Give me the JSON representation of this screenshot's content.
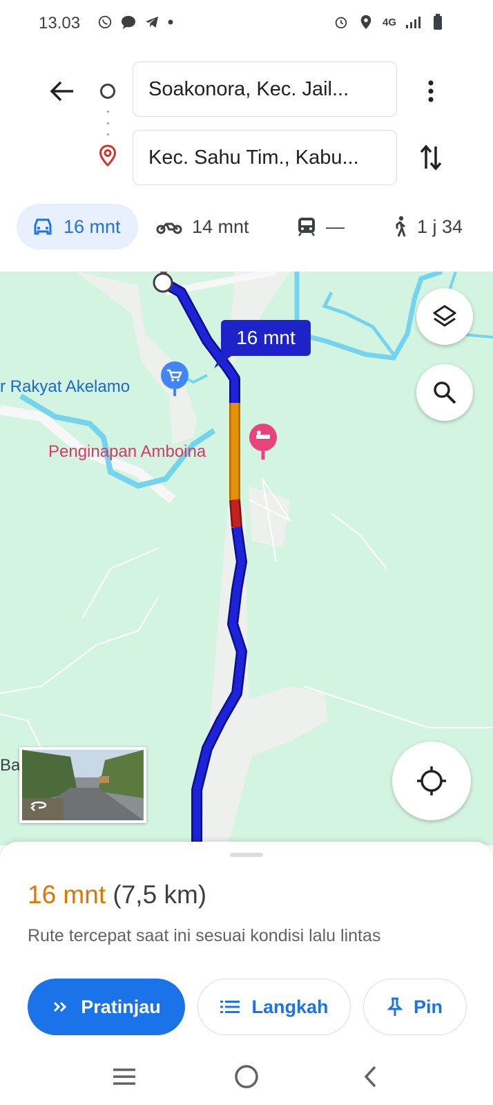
{
  "status_bar": {
    "time": "13.03",
    "network": "4G",
    "icons_left": [
      "whatsapp-icon",
      "chat-bubble-icon",
      "telegram-icon",
      "dot-icon"
    ],
    "icons_right": [
      "alarm-icon",
      "location-icon",
      "signal-icon",
      "battery-icon"
    ]
  },
  "directions": {
    "origin": "Soakonora, Kec. Jail...",
    "destination": "Kec. Sahu Tim., Kabu..."
  },
  "travel_modes": [
    {
      "icon": "car-icon",
      "label": "16 mnt",
      "active": true
    },
    {
      "icon": "motorcycle-icon",
      "label": "14 mnt",
      "active": false
    },
    {
      "icon": "train-icon",
      "label": "—",
      "active": false
    },
    {
      "icon": "walk-icon",
      "label": "1 j 34",
      "active": false
    }
  ],
  "map": {
    "eta_bubble": "16 mnt",
    "labels": {
      "market": "r Rakyat Akelamo",
      "inn": "Penginapan Amboina",
      "bar": "Bar"
    },
    "colors": {
      "route": "#1d23d6",
      "traffic_medium": "#e3900a",
      "traffic_heavy": "#c5221f",
      "water": "#74d4ee",
      "land": "#d4f4e2",
      "roads": "#f1f3f4"
    }
  },
  "route_summary": {
    "duration": "16 mnt",
    "distance": "(7,5 km)",
    "note": "Rute tercepat saat ini sesuai kondisi lalu lintas"
  },
  "actions": {
    "preview": "Pratinjau",
    "steps": "Langkah",
    "pin": "Pin"
  }
}
